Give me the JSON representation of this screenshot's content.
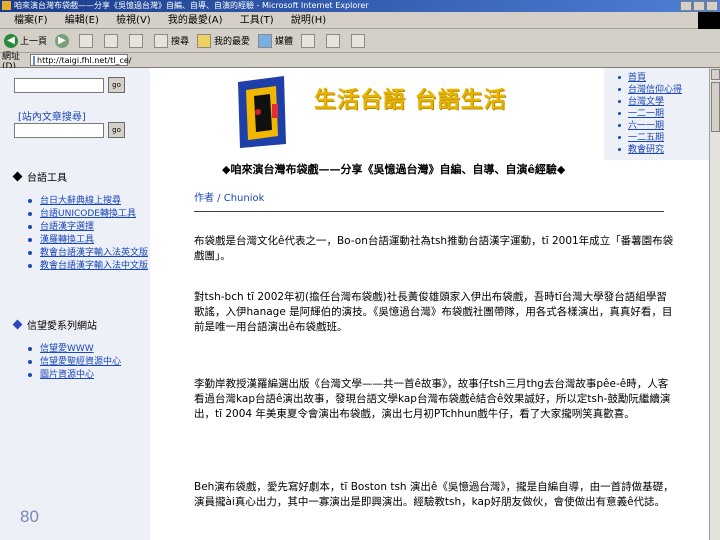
{
  "window": {
    "title": "咱來演台灣布袋戲——分享《吳憶過台灣》自編、自導、自演的經驗 - Microsoft Internet Explorer"
  },
  "menubar": [
    "檔案(F)",
    "編輯(E)",
    "檢視(V)",
    "我的最愛(A)",
    "工具(T)",
    "說明(H)"
  ],
  "toolbar": {
    "back": "上一頁",
    "search": "搜尋",
    "favorites": "我的最愛",
    "media": "媒體"
  },
  "address": {
    "label": "網址(D)",
    "value": "http://taigi.fhl.net/tl_ce/"
  },
  "sidebar": {
    "search1_go": "go",
    "search2_label": "[站內文章搜尋]",
    "search2_go": "go",
    "section1_title": "台語工具",
    "tools": [
      "台日大辭典線上搜尋",
      "台語UNICODE轉換工具",
      "台語漢字選擇",
      "漢羅轉換工具",
      "教會台語漢字輸入法英文版",
      "教會台語漢字輸入法中文版"
    ],
    "section2_title": "信望愛系列網站",
    "links": [
      "信望愛WWW",
      "信望愛聖經資源中心",
      "圖片資源中心"
    ]
  },
  "banner": {
    "title": "生活台語  台語生活"
  },
  "right_nav": [
    "首頁",
    "台灣信仰心得",
    "台灣文學",
    "一二一期",
    "六一一期",
    "一二五期",
    "教會研究"
  ],
  "article": {
    "title": "◆咱來演台灣布袋戲——分享《吳憶過台灣》自編、自導、自演ê經驗◆",
    "author": "作者 / Chuniok",
    "paragraphs": [
      "布袋戲是台灣文化ê代表之一，Bo-on台語運動社為tsh推動台語漢字運動，tī 2001年成立「番薯園布袋戲團」。",
      "對tsh-bch tī 2002年初(擔任台灣布袋戲)社長黃俊雄頭家入伊出布袋戲，吾時tī台灣大學發台語組學習歌謠，入伊hanage 是阿輝伯的演技。《吳憶過台灣》布袋戲社團帶隊，用各式各樣演出，真真好看，目前是唯一用台語演出ê布袋戲班。",
      "李勤岸教授漢羅編選出版《台灣文學——共一首ê故事》，故事仔tsh三月thg去台灣故事pêe-ê時，人客看過台灣kap台語ê演出故事，發現台語文學kap台灣布袋戲ê結合ê效果誠好，所以定tsh-鼓勵阮繼續演出，tī 2004 年美東夏令會演出布袋戲，演出七月初PTchhun戲牛仔，看了大家攏咧笑真歡喜。",
      "Beh演布袋戲，愛先寫好劇本，tī Boston tsh 演出ê《吳憶過台灣》，攏是自編自導，由一首詩做基礎，演員攏ài真心出力，其中一寡演出是即興演出。經驗教tsh，kap好朋友做伙，會使做出有意義ê代誌。"
    ]
  },
  "page_number": "80"
}
